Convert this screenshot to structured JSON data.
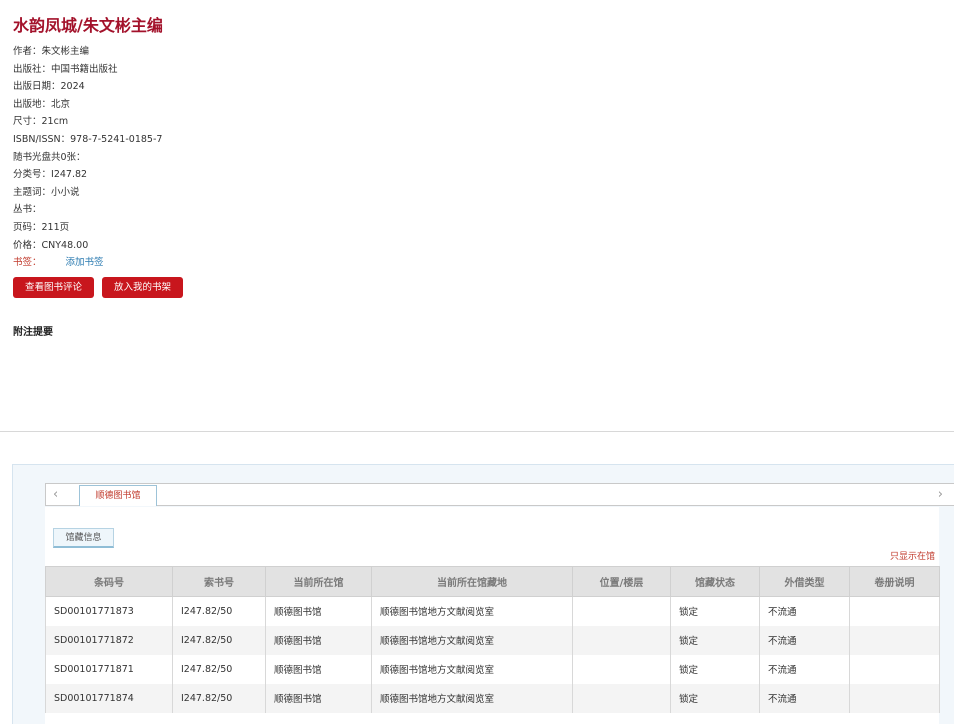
{
  "book": {
    "title": "水韵凤城/朱文彬主编"
  },
  "meta": [
    {
      "label": "作者：",
      "value": "朱文彬主编"
    },
    {
      "label": "出版社：",
      "value": "中国书籍出版社"
    },
    {
      "label": "出版日期：",
      "value": "2024"
    },
    {
      "label": "出版地：",
      "value": "北京"
    },
    {
      "label": "尺寸：",
      "value": "21cm"
    },
    {
      "label": "ISBN/ISSN：",
      "value": "978-7-5241-0185-7"
    },
    {
      "label": "随书光盘共0张：",
      "value": ""
    },
    {
      "label": "分类号：",
      "value": "I247.82"
    },
    {
      "label": "主题词：",
      "value": "小小说"
    },
    {
      "label": "丛书：",
      "value": ""
    },
    {
      "label": "页码：",
      "value": "211页"
    },
    {
      "label": "价格：",
      "value": "CNY48.00"
    }
  ],
  "bookmark": {
    "label": "书签：",
    "add_link": "添加书签"
  },
  "buttons": {
    "review": "查看图书评论",
    "shelf": "放入我的书架"
  },
  "notes": {
    "title": "附注提要"
  },
  "holdings": {
    "library_tab": "顺德图书馆",
    "info_tab": "馆藏信息",
    "only_this_link": "只显示在馆",
    "nav": {
      "left": "‹",
      "right": "›"
    },
    "columns": [
      "条码号",
      "索书号",
      "当前所在馆",
      "当前所在馆藏地",
      "位置/楼层",
      "馆藏状态",
      "外借类型",
      "卷册说明"
    ],
    "rows": [
      [
        "SD00101771873",
        "I247.82/50",
        "顺德图书馆",
        "顺德图书馆地方文献阅览室",
        "",
        "锁定",
        "不流通",
        ""
      ],
      [
        "SD00101771872",
        "I247.82/50",
        "顺德图书馆",
        "顺德图书馆地方文献阅览室",
        "",
        "锁定",
        "不流通",
        ""
      ],
      [
        "SD00101771871",
        "I247.82/50",
        "顺德图书馆",
        "顺德图书馆地方文献阅览室",
        "",
        "锁定",
        "不流通",
        ""
      ],
      [
        "SD00101771874",
        "I247.82/50",
        "顺德图书馆",
        "顺德图书馆地方文献阅览室",
        "",
        "锁定",
        "不流通",
        ""
      ]
    ]
  }
}
